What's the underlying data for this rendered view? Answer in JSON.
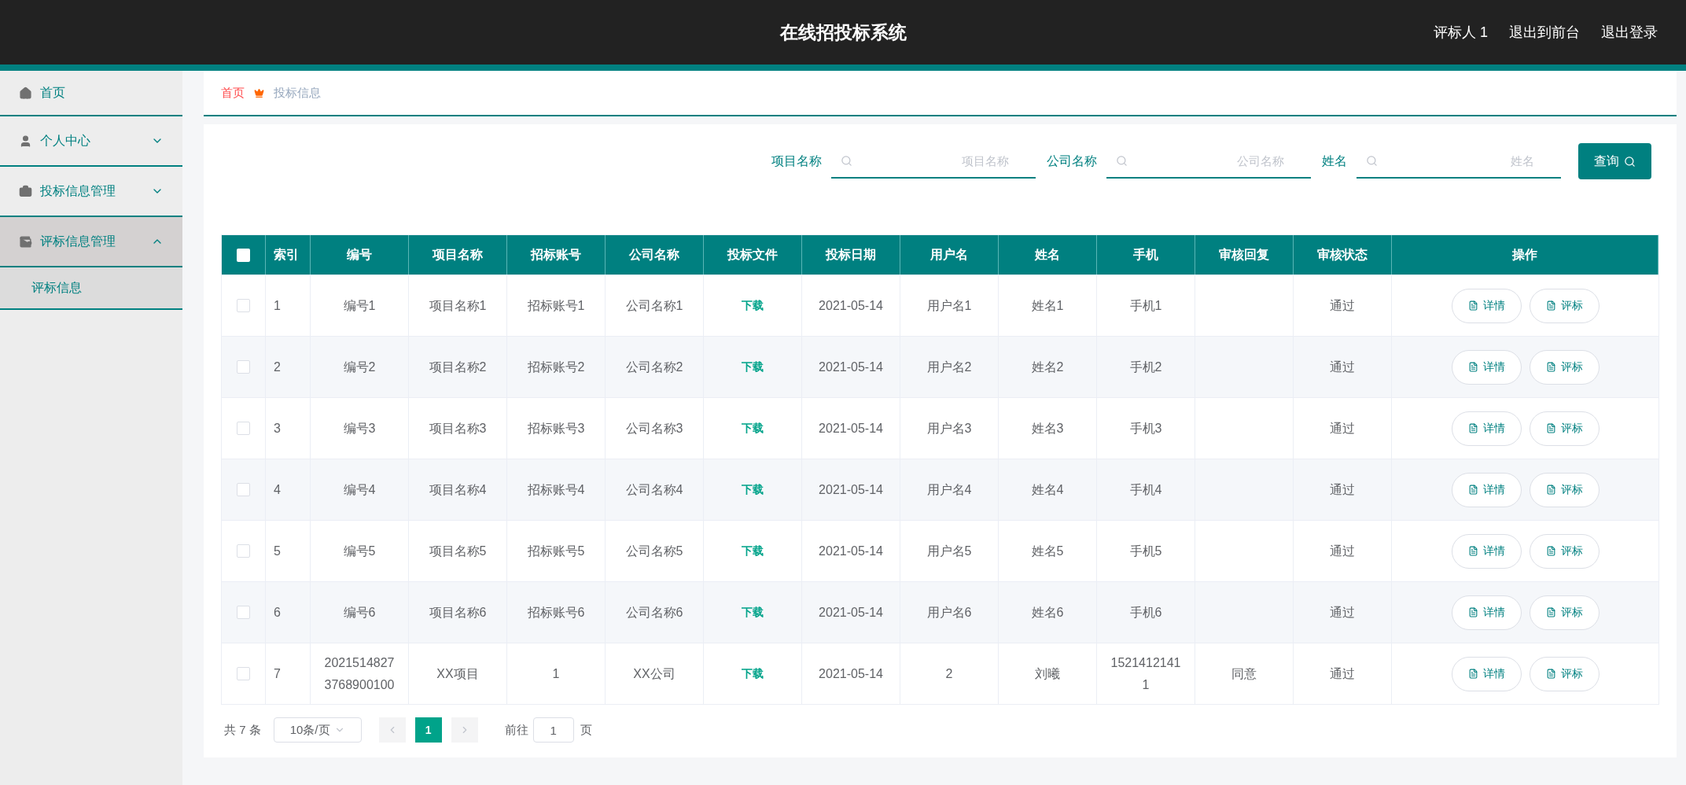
{
  "header": {
    "title": "在线招投标系统",
    "links": [
      "评标人 1",
      "退出到前台",
      "退出登录"
    ]
  },
  "sidebar": {
    "items": [
      {
        "label": "首页",
        "selected": false
      },
      {
        "label": "个人中心",
        "expanded": false,
        "selected": false
      },
      {
        "label": "投标信息管理",
        "expanded": false,
        "selected": false
      },
      {
        "label": "评标信息管理",
        "expanded": true,
        "selected": true,
        "children": [
          {
            "label": "评标信息",
            "selected": true
          }
        ]
      }
    ]
  },
  "breadcrumb": [
    "首页",
    "投标信息"
  ],
  "search": {
    "fields": [
      {
        "label": "项目名称",
        "placeholder": "项目名称"
      },
      {
        "label": "公司名称",
        "placeholder": "公司名称"
      },
      {
        "label": "姓名",
        "placeholder": "姓名"
      }
    ],
    "button": "查询"
  },
  "table": {
    "all_checked": false,
    "columns": [
      "索引",
      "编号",
      "项目名称",
      "招标账号",
      "公司名称",
      "投标文件",
      "投标日期",
      "用户名",
      "姓名",
      "手机",
      "审核回复",
      "审核状态",
      "操作"
    ],
    "rows": [
      {
        "checked": false,
        "cells": [
          "1",
          "编号1",
          "项目名称1",
          "招标账号1",
          "公司名称1",
          "下载",
          "2021-05-14",
          "用户名1",
          "姓名1",
          "手机1",
          "",
          "通过"
        ],
        "actions": [
          "详情",
          "评标"
        ]
      },
      {
        "checked": false,
        "cells": [
          "2",
          "编号2",
          "项目名称2",
          "招标账号2",
          "公司名称2",
          "下载",
          "2021-05-14",
          "用户名2",
          "姓名2",
          "手机2",
          "",
          "通过"
        ],
        "actions": [
          "详情",
          "评标"
        ]
      },
      {
        "checked": false,
        "cells": [
          "3",
          "编号3",
          "项目名称3",
          "招标账号3",
          "公司名称3",
          "下载",
          "2021-05-14",
          "用户名3",
          "姓名3",
          "手机3",
          "",
          "通过"
        ],
        "actions": [
          "详情",
          "评标"
        ]
      },
      {
        "checked": false,
        "cells": [
          "4",
          "编号4",
          "项目名称4",
          "招标账号4",
          "公司名称4",
          "下载",
          "2021-05-14",
          "用户名4",
          "姓名4",
          "手机4",
          "",
          "通过"
        ],
        "actions": [
          "详情",
          "评标"
        ]
      },
      {
        "checked": false,
        "cells": [
          "5",
          "编号5",
          "项目名称5",
          "招标账号5",
          "公司名称5",
          "下载",
          "2021-05-14",
          "用户名5",
          "姓名5",
          "手机5",
          "",
          "通过"
        ],
        "actions": [
          "详情",
          "评标"
        ]
      },
      {
        "checked": false,
        "cells": [
          "6",
          "编号6",
          "项目名称6",
          "招标账号6",
          "公司名称6",
          "下载",
          "2021-05-14",
          "用户名6",
          "姓名6",
          "手机6",
          "",
          "通过"
        ],
        "actions": [
          "详情",
          "评标"
        ]
      },
      {
        "checked": false,
        "cells": [
          "7",
          "20215148273768900100",
          "XX项目",
          "1",
          "XX公司",
          "下载",
          "2021-05-14",
          "2",
          "刘曦",
          "15214121411",
          "同意",
          "通过"
        ],
        "actions": [
          "详情",
          "评标"
        ]
      }
    ]
  },
  "pagination": {
    "total": "共 7 条",
    "page_size": "10条/页",
    "pages": [
      {
        "label": "1",
        "selected": true
      }
    ],
    "goto_label": "前往",
    "goto_value": "1",
    "goto_suffix": "页"
  }
}
